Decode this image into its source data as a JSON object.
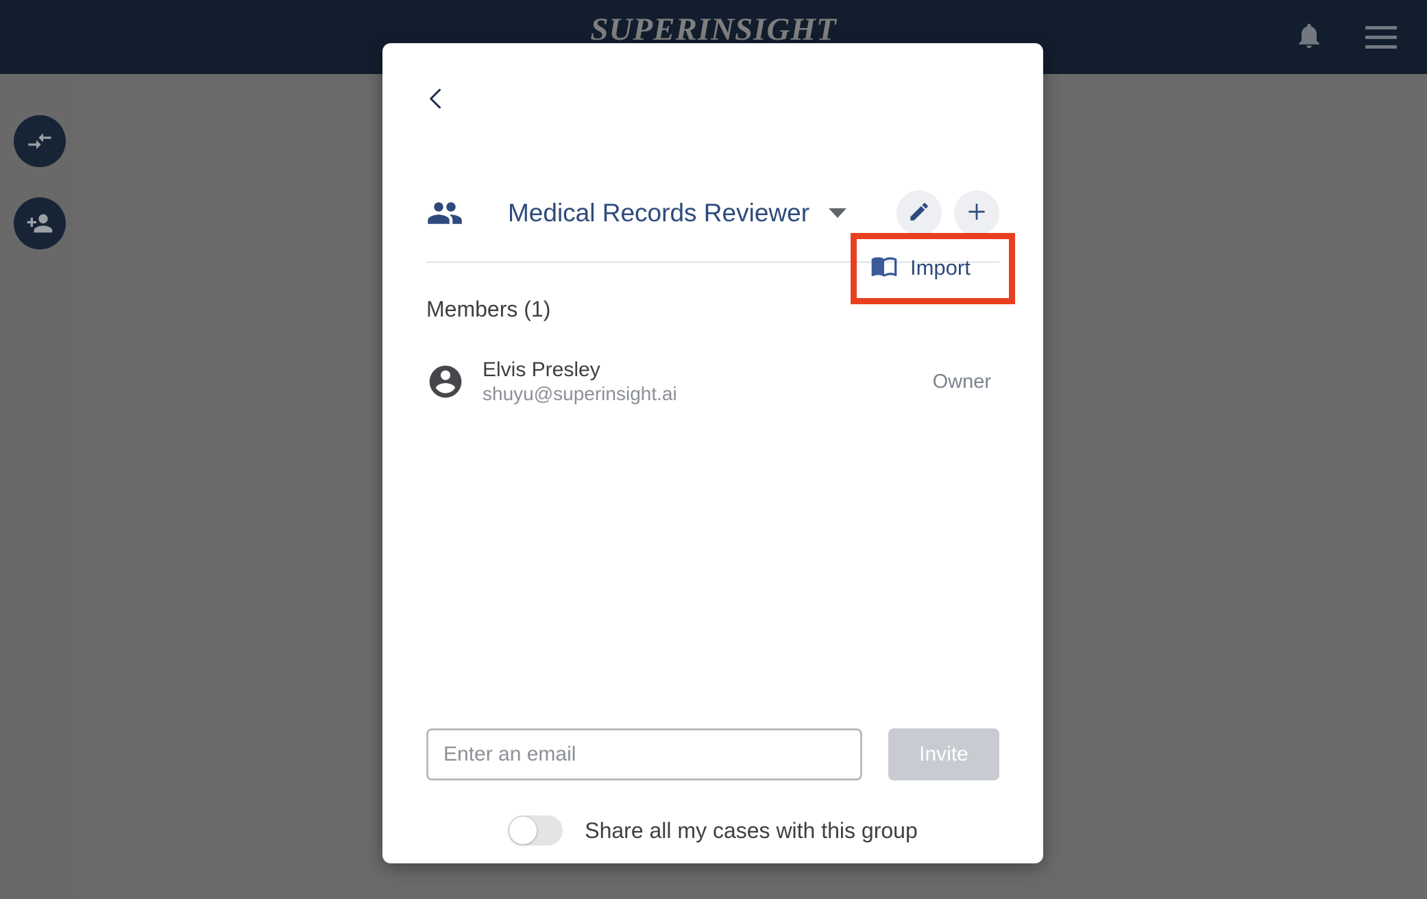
{
  "topbar": {
    "brand": "SUPERINSIGHT",
    "notifications_icon": "bell-icon",
    "menu_icon": "hamburger-menu-icon"
  },
  "left_rail": {
    "items": [
      {
        "icon": "compare-arrows-icon"
      },
      {
        "icon": "person-add-icon"
      }
    ]
  },
  "modal": {
    "back_icon": "chevron-left-icon",
    "group_icon": "people-group-icon",
    "group_name": "Medical Records Reviewer",
    "dropdown_icon": "caret-down-icon",
    "edit_icon": "pencil-icon",
    "add_icon": "plus-icon",
    "members_label": "Members (1)",
    "import": {
      "label": "Import",
      "icon": "open-book-icon",
      "highlight_color": "#e8401f"
    },
    "members": [
      {
        "avatar_icon": "account-circle-icon",
        "name": "Elvis Presley",
        "email": "shuyu@superinsight.ai",
        "role": "Owner"
      }
    ],
    "invite": {
      "placeholder": "Enter an email",
      "value": "",
      "button_label": "Invite"
    },
    "share_toggle": {
      "label": "Share all my cases with this group",
      "state": "off"
    }
  },
  "colors": {
    "topbar_bg": "#121d2e",
    "overlay": "#6a6a6a",
    "accent_blue": "#2e4a7d",
    "highlight_red": "#e8401f"
  }
}
